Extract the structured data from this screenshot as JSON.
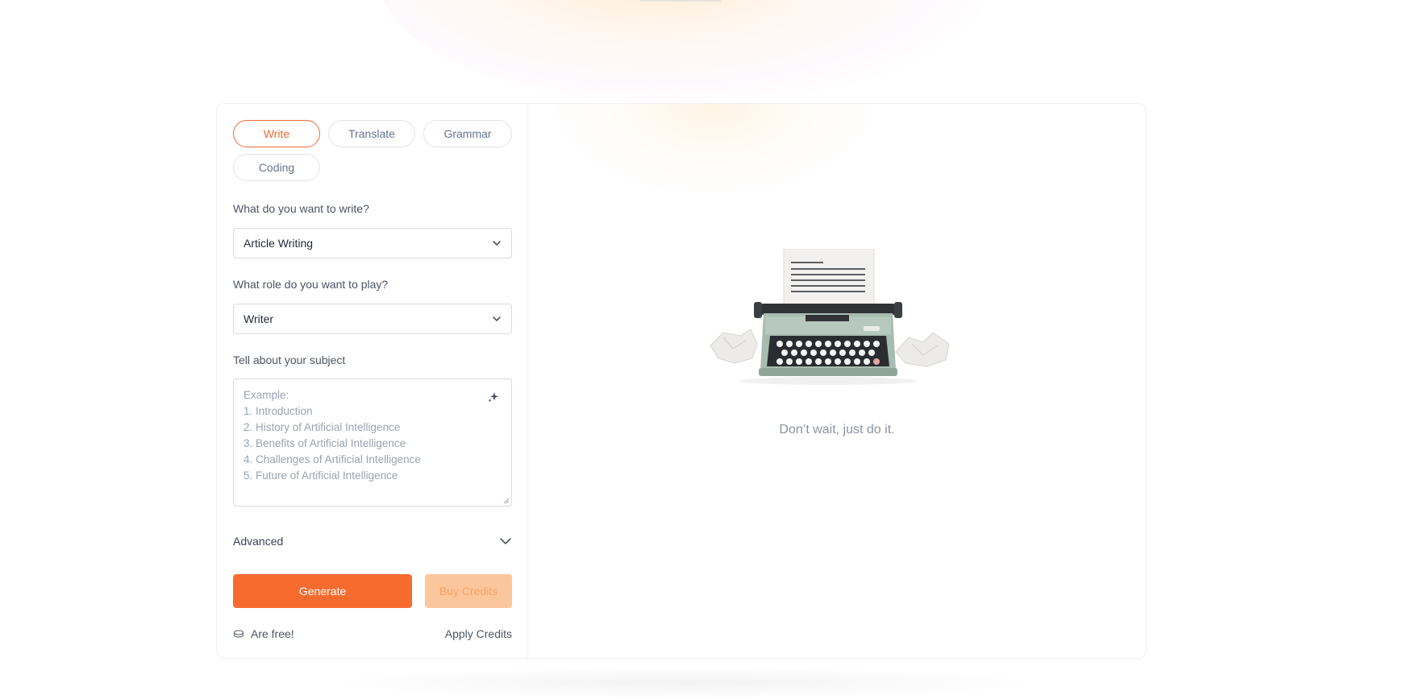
{
  "tabs": [
    {
      "label": "Write",
      "active": true
    },
    {
      "label": "Translate",
      "active": false
    },
    {
      "label": "Grammar",
      "active": false
    },
    {
      "label": "Coding",
      "active": false
    }
  ],
  "form": {
    "write_label": "What do you want to write?",
    "write_value": "Article Writing",
    "role_label": "What role do you want to play?",
    "role_value": "Writer",
    "subject_label": "Tell about your subject",
    "subject_placeholder": [
      "Example:",
      "1. Introduction",
      "2. History of Artificial Intelligence",
      "3. Benefits of Artificial Intelligence",
      "4. Challenges of Artificial Intelligence",
      "5. Future of Artificial Intelligence"
    ],
    "advanced_label": "Advanced"
  },
  "actions": {
    "generate_label": "Generate",
    "buy_label": "Buy Credits",
    "free_label": "Are free!",
    "apply_label": "Apply Credits"
  },
  "empty_state": {
    "tagline": "Don’t wait, just do it."
  },
  "colors": {
    "accent": "#f86b2f",
    "accent_light": "#fcc69c",
    "border": "#d6dbe1"
  },
  "icons": {
    "select_chevron": "chevron-down-icon",
    "sparkle": "sparkle-icon",
    "advanced_chevron": "chevron-down-icon",
    "credits": "coin-icon",
    "illustration": "typewriter-illustration"
  }
}
